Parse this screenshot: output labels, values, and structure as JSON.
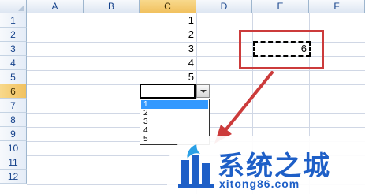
{
  "spreadsheet": {
    "columns": [
      "A",
      "B",
      "C",
      "D",
      "E",
      "F"
    ],
    "active_column": "C",
    "rows": [
      "1",
      "2",
      "3",
      "4",
      "5",
      "6",
      "7",
      "8",
      "9",
      "10",
      "11",
      "12"
    ],
    "active_row": "6",
    "column_c_values": [
      "1",
      "2",
      "3",
      "4",
      "5"
    ],
    "copied_cell_value": "6"
  },
  "dropdown": {
    "options": [
      "1",
      "2",
      "3",
      "4",
      "5"
    ],
    "selected_option": "1"
  },
  "watermark": {
    "title": "系统之城",
    "url": "xitong86.com"
  },
  "colors": {
    "annotation": "#cc3b3b",
    "watermark": "#1e5fc7",
    "selection": "#3399ff",
    "active_header": "#f1c15f"
  },
  "icons": [
    "dropdown-arrow-icon",
    "select-all-triangle-icon",
    "logo-icon"
  ]
}
